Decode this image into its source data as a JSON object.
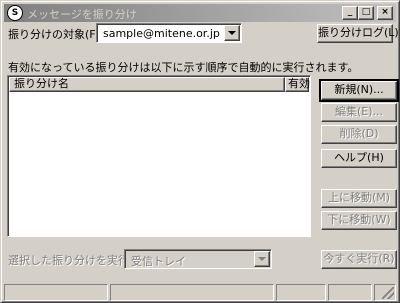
{
  "window": {
    "title": "メッセージを振り分け",
    "minimize": "_",
    "maximize": "□",
    "close": "×"
  },
  "target": {
    "label": "振り分けの対象(F):",
    "value": "sample@mitene.or.jp"
  },
  "log_button": "振り分けログ(L)",
  "info_text": "有効になっている振り分けは以下に示す順序で自動的に実行されます。",
  "list": {
    "columns": [
      "振り分け名",
      "有効"
    ],
    "rows": []
  },
  "buttons": {
    "new": "新規(N)...",
    "edit": "編集(E)...",
    "delete": "削除(D)",
    "help": "ヘルプ(H)",
    "move_up": "上に移動(M)",
    "move_down": "下に移動(W)",
    "run_now": "今すぐ実行(R)"
  },
  "run_selected": {
    "label": "選択した振り分けを実行(I):",
    "value": "受信トレイ"
  }
}
